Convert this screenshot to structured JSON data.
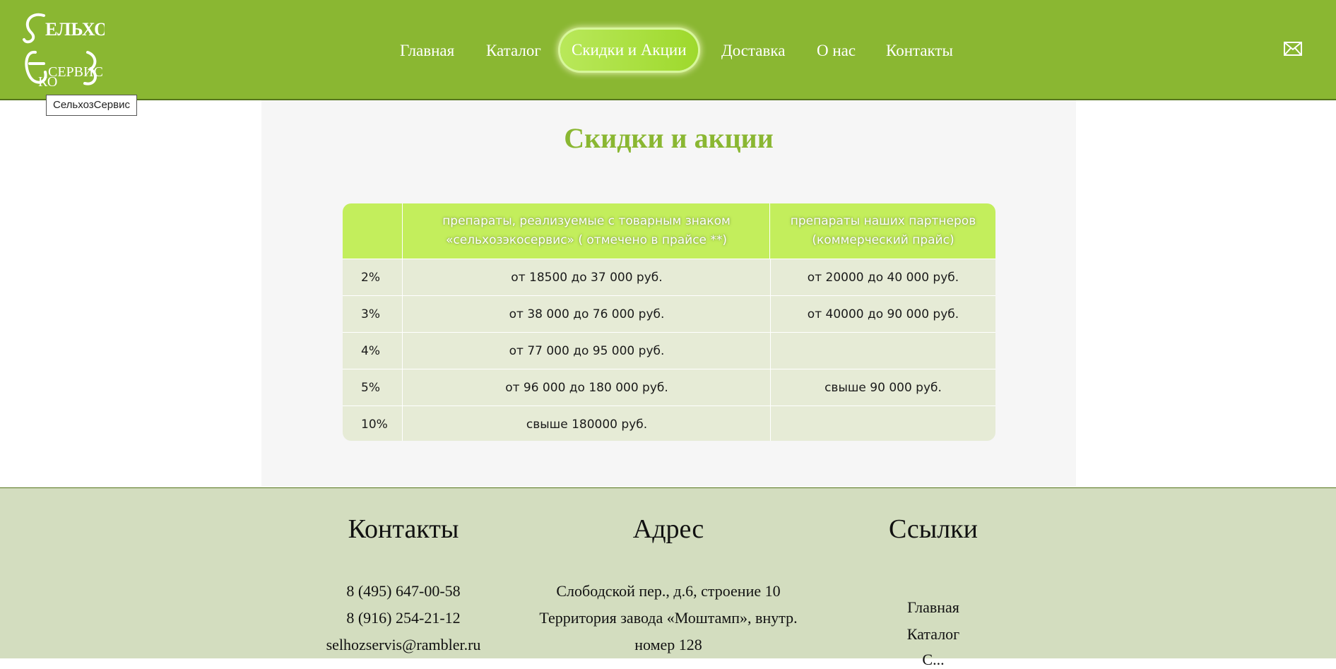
{
  "header": {
    "logo_text": "СельхозЭкоСервис",
    "logo_tooltip": "СельхозСервис",
    "nav": [
      {
        "label": "Главная"
      },
      {
        "label": "Каталог"
      },
      {
        "label": "Скидки и Акции"
      },
      {
        "label": "Доставка"
      },
      {
        "label": "О нас"
      },
      {
        "label": "Контакты"
      }
    ],
    "active_nav": "Скидки и Акции",
    "mail_icon": "envelope-icon"
  },
  "main": {
    "title": "Скидки и акции",
    "table": {
      "headers": [
        "",
        "препараты, реализуемые с товарным знаком «сельхозэкосервис» ( отмечено в прайсе **)",
        "препараты наших партнеров (коммерческий прайс)"
      ],
      "rows": [
        [
          "2%",
          "от 18500 до 37 000 руб.",
          "от 20000 до 40 000 руб."
        ],
        [
          "3%",
          "от 38 000 до 76 000 руб.",
          "от 40000 до 90 000 руб."
        ],
        [
          "4%",
          "от 77 000 до 95 000 руб.",
          ""
        ],
        [
          "5%",
          "от 96 000 до 180 000 руб.",
          "свыше 90 000 руб."
        ],
        [
          "10%",
          "свыше 180000 руб.",
          ""
        ]
      ]
    }
  },
  "footer": {
    "contacts": {
      "title": "Контакты",
      "lines": [
        "8 (495) 647-00-58",
        "8 (916) 254-21-12",
        "selhozservis@rambler.ru"
      ]
    },
    "address": {
      "title": "Адрес",
      "lines": [
        "Слободской пер., д.6, строение 10",
        "Территория завода «Моштамп», внутр.",
        "номер 128"
      ]
    },
    "links": {
      "title": "Ссылки",
      "items": [
        "Главная",
        "Каталог",
        "С..."
      ]
    }
  },
  "colors": {
    "brand_green": "#8ab732",
    "table_header": "#c3ee5c",
    "table_row": "#e6ebd6",
    "footer_bg": "#d3ddbf"
  }
}
